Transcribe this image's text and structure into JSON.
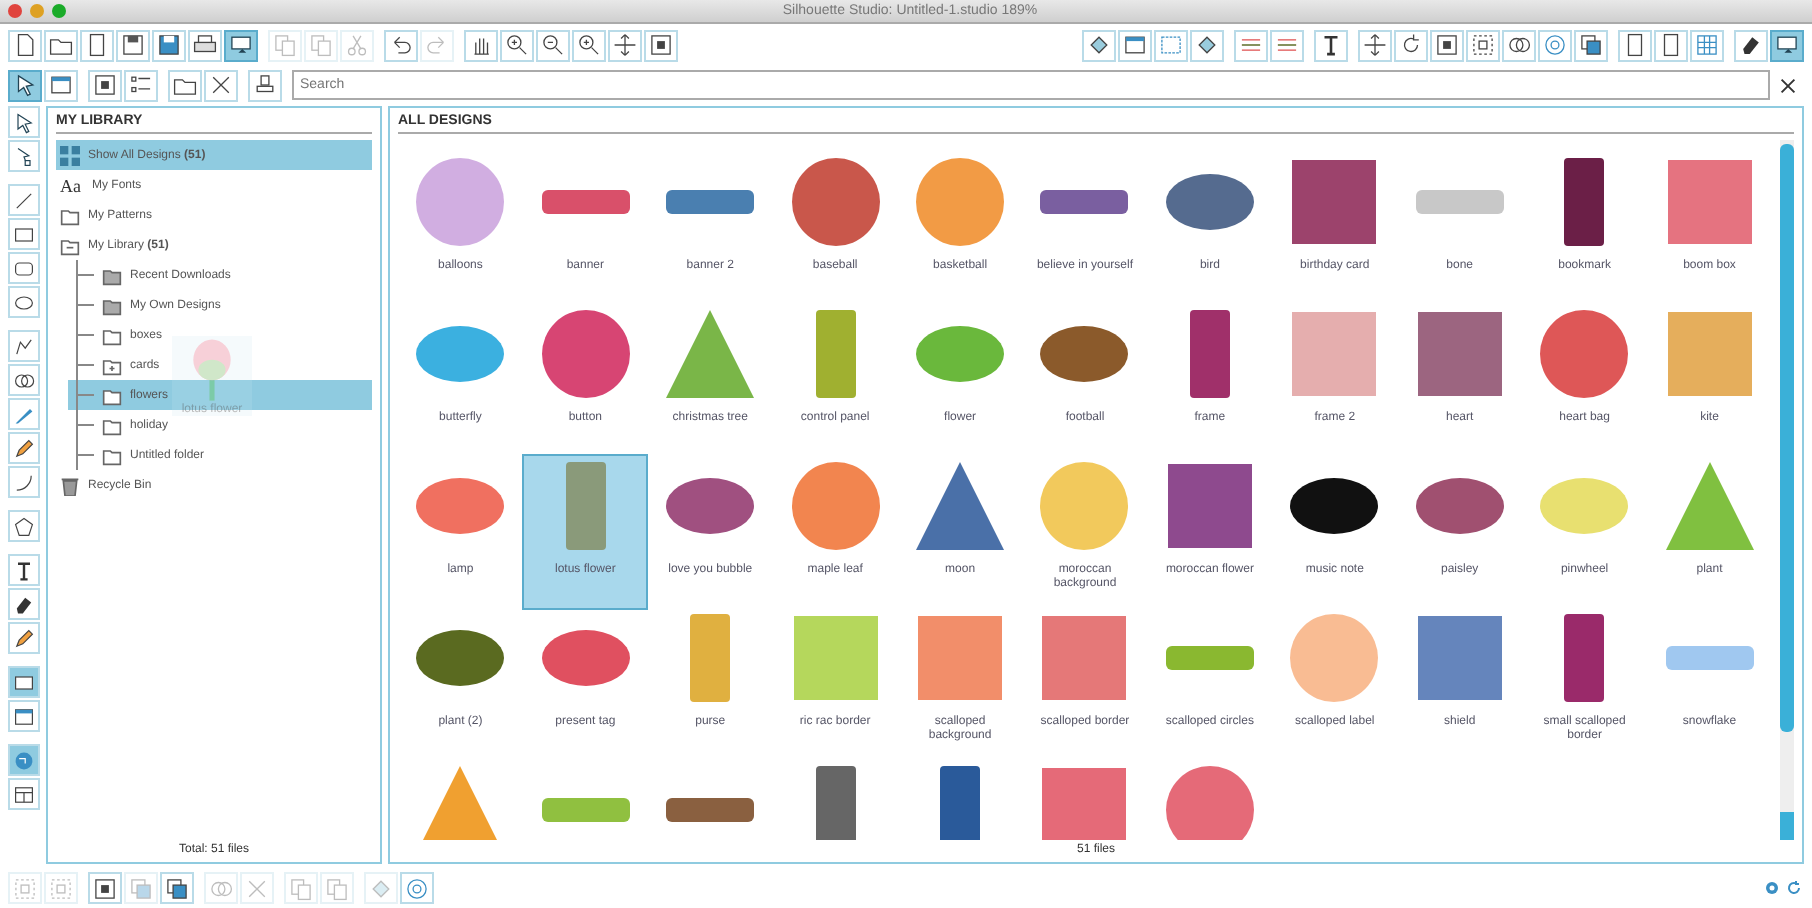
{
  "window": {
    "title": "Silhouette Studio: Untitled-1.studio 189%"
  },
  "top_toolbar_left": [
    {
      "selected": false,
      "disabled": false
    },
    {
      "selected": false,
      "disabled": false
    },
    {
      "selected": false,
      "disabled": false
    },
    {
      "selected": false,
      "disabled": false
    },
    {
      "selected": false,
      "disabled": false
    },
    {
      "selected": false,
      "disabled": false
    },
    {
      "selected": true,
      "disabled": false
    },
    {
      "selected": false,
      "disabled": true
    },
    {
      "selected": false,
      "disabled": true
    },
    {
      "selected": false,
      "disabled": true
    },
    {
      "selected": false,
      "disabled": false
    },
    {
      "selected": false,
      "disabled": true
    },
    {
      "selected": false,
      "disabled": false
    },
    {
      "selected": false,
      "disabled": false
    },
    {
      "selected": false,
      "disabled": false
    },
    {
      "selected": false,
      "disabled": false
    },
    {
      "selected": false,
      "disabled": false
    },
    {
      "selected": false,
      "disabled": false
    }
  ],
  "top_toolbar_right": [
    {
      "selected": false
    },
    {
      "selected": false
    },
    {
      "selected": false
    },
    {
      "selected": false
    },
    {
      "selected": false
    },
    {
      "selected": false
    },
    {
      "selected": false
    },
    {
      "selected": false
    },
    {
      "selected": false
    },
    {
      "selected": false
    },
    {
      "selected": false
    },
    {
      "selected": false
    },
    {
      "selected": false
    },
    {
      "selected": false
    },
    {
      "selected": false
    },
    {
      "selected": false
    },
    {
      "selected": false
    },
    {
      "selected": false
    },
    {
      "selected": true
    }
  ],
  "library_toolbar": [
    {
      "selected": true
    },
    {
      "selected": false
    },
    {
      "selected": false
    },
    {
      "selected": false
    },
    {
      "selected": false
    },
    {
      "selected": false
    },
    {
      "selected": false
    }
  ],
  "search": {
    "placeholder": "Search"
  },
  "tool_strip": [
    {
      "selected": false
    },
    {
      "selected": false
    },
    {
      "selected": false
    },
    {
      "selected": false
    },
    {
      "selected": false
    },
    {
      "selected": false
    },
    {
      "selected": false
    },
    {
      "selected": false
    },
    {
      "selected": false
    },
    {
      "selected": false
    },
    {
      "selected": false
    },
    {
      "selected": false
    },
    {
      "selected": false
    },
    {
      "selected": false
    },
    {
      "selected": false
    },
    {
      "selected": true
    },
    {
      "selected": false
    },
    {
      "selected": true
    },
    {
      "selected": false
    }
  ],
  "library": {
    "title": "MY LIBRARY",
    "items": [
      {
        "kind": "grid",
        "label": "Show All Designs **(51)**",
        "selected": true
      },
      {
        "kind": "fonts",
        "icon_text": "Aa",
        "label": "My Fonts",
        "selected": false
      },
      {
        "kind": "folder",
        "label": "My Patterns",
        "selected": false
      },
      {
        "kind": "library",
        "label": "My Library **(51)**",
        "selected": false,
        "expanded": true,
        "children": [
          {
            "kind": "folder-filled",
            "label": "Recent Downloads",
            "selected": false
          },
          {
            "kind": "folder-filled",
            "label": "My Own Designs",
            "selected": false
          },
          {
            "kind": "folder",
            "label": "boxes",
            "selected": false
          },
          {
            "kind": "folder-plus",
            "label": "cards",
            "selected": false
          },
          {
            "kind": "folder",
            "label": "flowers",
            "selected": true
          },
          {
            "kind": "folder",
            "label": "holiday",
            "selected": false
          },
          {
            "kind": "folder",
            "label": "Untitled folder",
            "selected": false
          }
        ]
      },
      {
        "kind": "trash",
        "label": "Recycle Bin",
        "selected": false
      }
    ],
    "total": "Total: 51 files"
  },
  "drag_preview": {
    "label": "lotus flower"
  },
  "designs": {
    "title": "ALL DESIGNS",
    "items": [
      {
        "label": "balloons",
        "selected": false
      },
      {
        "label": "banner",
        "selected": false
      },
      {
        "label": "banner 2",
        "selected": false
      },
      {
        "label": "baseball",
        "selected": false
      },
      {
        "label": "basketball",
        "selected": false
      },
      {
        "label": "believe in yourself",
        "selected": false
      },
      {
        "label": "bird",
        "selected": false
      },
      {
        "label": "birthday card",
        "selected": false
      },
      {
        "label": "bone",
        "selected": false
      },
      {
        "label": "bookmark",
        "selected": false
      },
      {
        "label": "boom box",
        "selected": false
      },
      {
        "label": "butterfly",
        "selected": false
      },
      {
        "label": "button",
        "selected": false
      },
      {
        "label": "christmas tree",
        "selected": false
      },
      {
        "label": "control panel",
        "selected": false
      },
      {
        "label": "flower",
        "selected": false
      },
      {
        "label": "football",
        "selected": false
      },
      {
        "label": "frame",
        "selected": false
      },
      {
        "label": "frame 2",
        "selected": false
      },
      {
        "label": "heart",
        "selected": false
      },
      {
        "label": "heart bag",
        "selected": false
      },
      {
        "label": "kite",
        "selected": false
      },
      {
        "label": "lamp",
        "selected": false
      },
      {
        "label": "lotus flower",
        "selected": true
      },
      {
        "label": "love you bubble",
        "selected": false
      },
      {
        "label": "maple leaf",
        "selected": false
      },
      {
        "label": "moon",
        "selected": false
      },
      {
        "label": "moroccan background",
        "selected": false
      },
      {
        "label": "moroccan flower",
        "selected": false
      },
      {
        "label": "music note",
        "selected": false
      },
      {
        "label": "paisley",
        "selected": false
      },
      {
        "label": "pinwheel",
        "selected": false
      },
      {
        "label": "plant",
        "selected": false
      },
      {
        "label": "plant (2)",
        "selected": false
      },
      {
        "label": "present tag",
        "selected": false
      },
      {
        "label": "purse",
        "selected": false
      },
      {
        "label": "ric rac border",
        "selected": false
      },
      {
        "label": "scalloped background",
        "selected": false
      },
      {
        "label": "scalloped border",
        "selected": false
      },
      {
        "label": "scalloped circles",
        "selected": false
      },
      {
        "label": "scalloped label",
        "selected": false
      },
      {
        "label": "shield",
        "selected": false
      },
      {
        "label": "small scalloped border",
        "selected": false
      },
      {
        "label": "snowflake",
        "selected": false
      },
      {
        "selected": false
      },
      {
        "selected": false
      },
      {
        "selected": false
      },
      {
        "selected": false
      },
      {
        "selected": false
      },
      {
        "selected": false
      },
      {
        "selected": false
      }
    ],
    "count": "51 files"
  },
  "bottom_toolbar": [
    {
      "disabled": true
    },
    {
      "disabled": true
    },
    {
      "disabled": false
    },
    {
      "disabled": true
    },
    {
      "disabled": false
    },
    {
      "disabled": true
    },
    {
      "disabled": true
    },
    {
      "disabled": true
    },
    {
      "disabled": true
    },
    {
      "disabled": true
    },
    {
      "disabled": false
    }
  ]
}
